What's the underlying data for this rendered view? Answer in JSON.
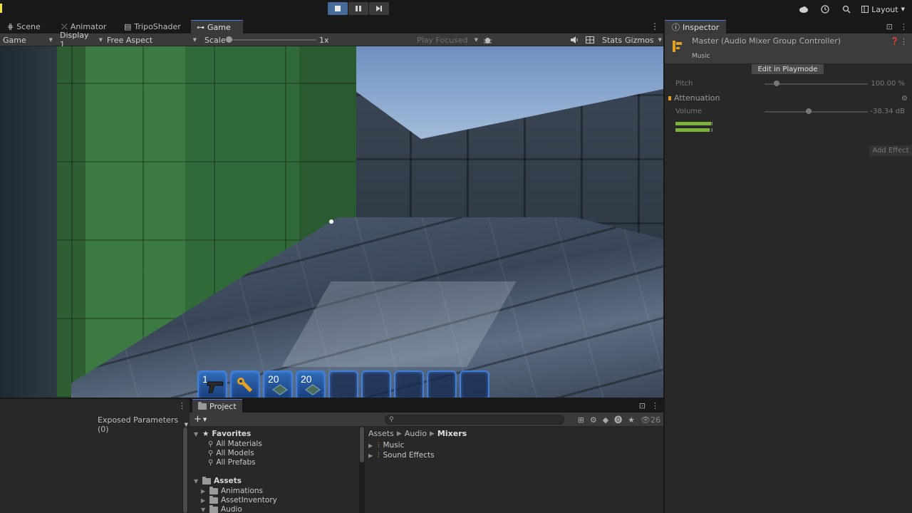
{
  "toolbar": {
    "play_buttons": [
      "stop-icon",
      "pause-icon",
      "step-icon"
    ],
    "layout_label": "Layout"
  },
  "game_panel": {
    "tabs": [
      {
        "label": "Scene",
        "icon": "grid-icon"
      },
      {
        "label": "Animator",
        "icon": "animator-icon"
      },
      {
        "label": "TripoShader",
        "icon": "shader-icon"
      },
      {
        "label": "Game",
        "icon": "gamepad-icon",
        "active": true
      }
    ],
    "toolbar": {
      "view_mode": "Game",
      "display": "Display 1",
      "aspect": "Free Aspect",
      "scale_label": "Scale",
      "scale_value": "1x",
      "play_focused": "Play Focused",
      "stats": "Stats",
      "gizmos": "Gizmos"
    },
    "hotbar": [
      {
        "count": "1",
        "icon": "pistol-icon",
        "filled": true
      },
      {
        "count": "",
        "icon": "wrench-icon",
        "filled": true
      },
      {
        "count": "20",
        "icon": "circuit-board-icon",
        "filled": true
      },
      {
        "count": "20",
        "icon": "circuit-board-icon",
        "filled": true
      },
      {
        "count": "",
        "icon": "",
        "filled": false
      },
      {
        "count": "",
        "icon": "",
        "filled": false
      },
      {
        "count": "",
        "icon": "",
        "filled": false
      },
      {
        "count": "",
        "icon": "",
        "filled": false
      },
      {
        "count": "",
        "icon": "",
        "filled": false
      }
    ]
  },
  "inspector": {
    "tab": "Inspector",
    "title": "Master (Audio Mixer Group Controller)",
    "subtitle": "Music",
    "edit_button": "Edit in Playmode",
    "pitch_label": "Pitch",
    "pitch_value": "100.00 %",
    "pitch_fraction": 0.12,
    "attenuation_label": "Attenuation",
    "volume_label": "Volume",
    "volume_value": "-38.34 dB",
    "volume_fraction": 0.43,
    "add_effect": "Add Effect",
    "accent": "#e0a020"
  },
  "mixer": {
    "exposed_params": "Exposed Parameters (0)"
  },
  "project": {
    "tab": "Project",
    "hidden_count": "26",
    "tree": {
      "favorites_label": "Favorites",
      "favorites": [
        "All Materials",
        "All Models",
        "All Prefabs"
      ],
      "assets_label": "Assets",
      "assets": [
        "Animations",
        "AssetInventory",
        "Audio"
      ]
    },
    "breadcrumb": [
      "Assets",
      "Audio",
      "Mixers"
    ],
    "files": [
      "Music",
      "Sound Effects"
    ]
  }
}
